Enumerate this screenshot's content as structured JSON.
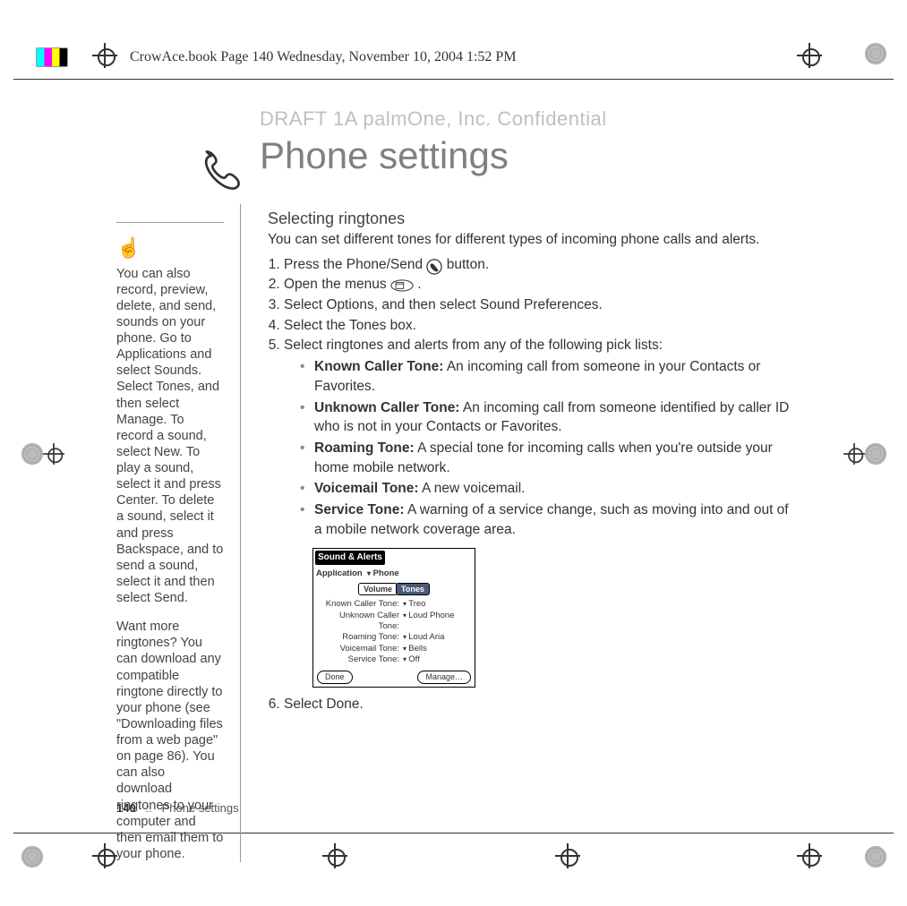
{
  "meta": {
    "header": "CrowAce.book  Page 140  Wednesday, November 10, 2004  1:52 PM",
    "watermark": "DRAFT 1A  palmOne, Inc.   Confidential",
    "title": "Phone settings"
  },
  "sidebar": {
    "tip1": "You can also record, preview, delete, and send, sounds on your phone. Go to Applications and select Sounds. Select Tones, and then select Manage. To record a sound, select New. To play a sound, select it and press Center. To delete a sound, select it and press Backspace, and to send a sound, select it and then select Send.",
    "tip2": "Want more ringtones? You can download any compatible ringtone directly to your phone (see \"Downloading files from a web page\" on page 86). You can also download ringtones to your computer and then email them to your phone."
  },
  "section": {
    "heading": "Selecting ringtones",
    "intro": "You can set different tones for different types of incoming phone calls and alerts.",
    "steps": {
      "s1a": "Press the Phone/Send ",
      "s1b": " button.",
      "s2a": "Open the menus ",
      "s2b": ".",
      "s3": "Select Options, and then select Sound Preferences.",
      "s4": "Select the Tones box.",
      "s5": "Select ringtones and alerts from any of the following pick lists:",
      "s6": "Select Done."
    },
    "bullets": [
      {
        "label": "Known Caller Tone:",
        "text": " An incoming call from someone in your Contacts or Favorites."
      },
      {
        "label": "Unknown Caller Tone:",
        "text": " An incoming call from someone identified by caller ID who is not in your Contacts or Favorites."
      },
      {
        "label": "Roaming Tone:",
        "text": " A special tone for incoming calls when you're outside your home mobile network."
      },
      {
        "label": "Voicemail Tone:",
        "text": " A new voicemail."
      },
      {
        "label": "Service Tone:",
        "text": " A warning of a service change, such as moving into and out of a mobile network coverage area."
      }
    ]
  },
  "palm": {
    "title": "Sound & Alerts",
    "app_label": "Application",
    "app_value": "Phone",
    "tab_volume": "Volume",
    "tab_tones": "Tones",
    "rows": [
      {
        "label": "Known Caller Tone:",
        "value": "Treo"
      },
      {
        "label": "Unknown Caller Tone:",
        "value": "Loud Phone"
      },
      {
        "label": "Roaming Tone:",
        "value": "Loud Aria"
      },
      {
        "label": "Voicemail Tone:",
        "value": "Bells"
      },
      {
        "label": "Service Tone:",
        "value": "Off"
      }
    ],
    "done": "Done",
    "manage": "Manage…"
  },
  "footer": {
    "page": "140",
    "sep": "::",
    "label": "Phone settings"
  }
}
